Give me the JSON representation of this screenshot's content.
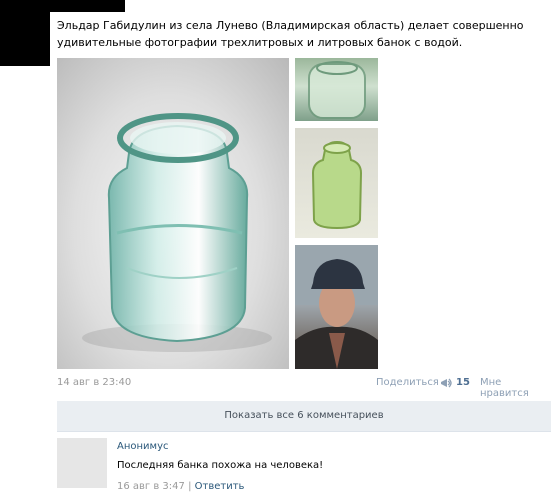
{
  "post": {
    "text": "Эльдар Габидулин из села Лунево (Владимирская область) делает совершенно удивительные фотографии трехлитровых и литровых банок с водой.",
    "date": "14 авг в 23:40",
    "share_label": "Поделиться",
    "share_count": "15",
    "like_label": "Мне нравится"
  },
  "show_all_comments": "Показать все 6 комментариев",
  "comment": {
    "author": "Анонимус",
    "text": "Последняя банка похожа на человека!",
    "date": "16 авг в 3:47",
    "separator": "|",
    "reply_label": "Ответить"
  },
  "icons": {
    "share": "megaphone-icon"
  },
  "colors": {
    "link": "#2b587a",
    "meta": "#9a9a9a",
    "button_bg": "#eaeef2"
  }
}
